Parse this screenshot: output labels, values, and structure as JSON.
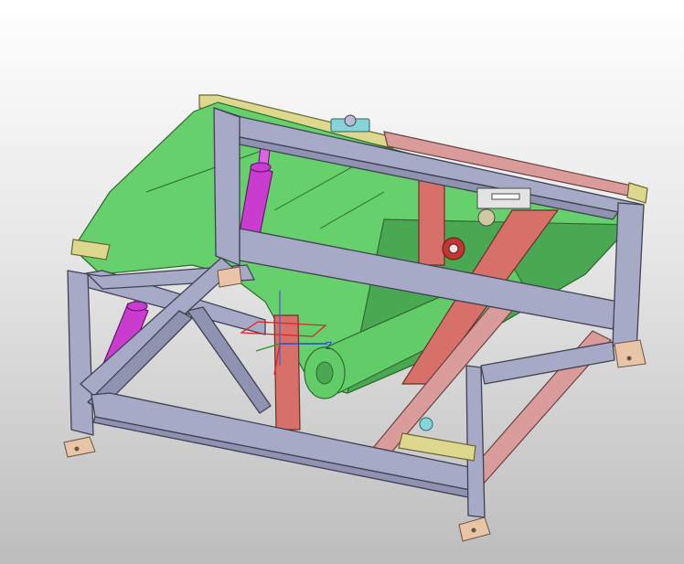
{
  "viewport": {
    "background_top": "#ffffff",
    "background_bottom": "#bdbdbd"
  },
  "model": {
    "frame_color": "#a7aac7",
    "belt_color": "#66d06c",
    "cylinder_color": "#c93ccf",
    "beam_color": "#d8706a",
    "feet_color": "#e7c5a6"
  },
  "triad": {
    "axis_label": "Z"
  }
}
